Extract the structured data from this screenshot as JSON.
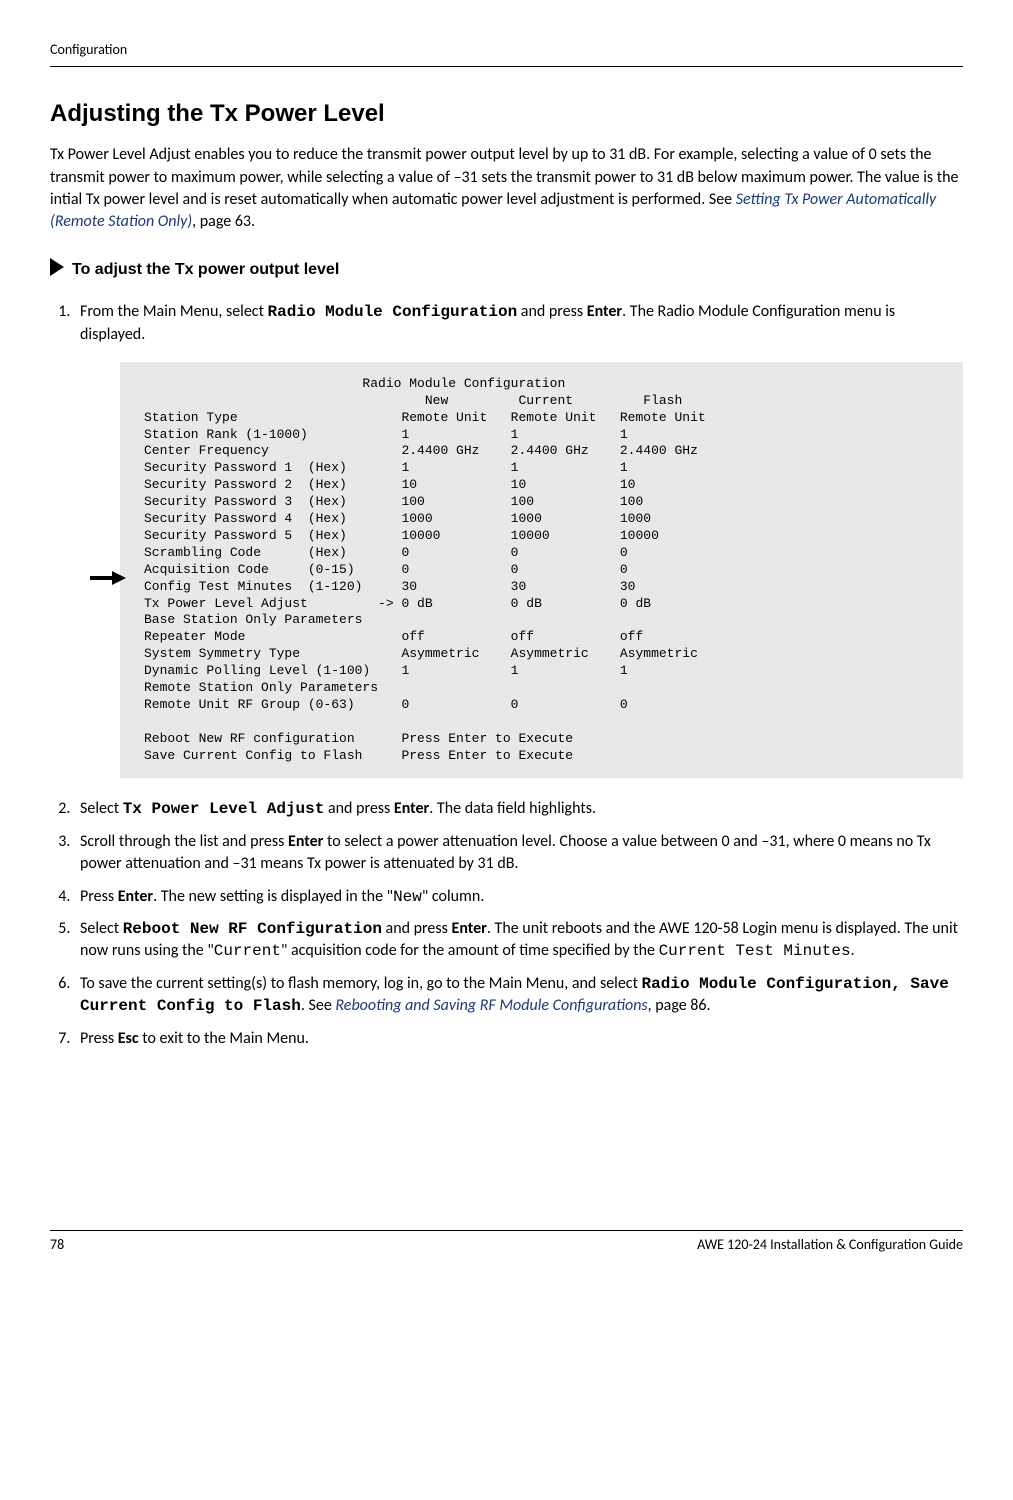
{
  "header": "Configuration",
  "heading": "Adjusting the Tx Power Level",
  "intro_pre": "Tx Power Level Adjust enables you to reduce the transmit power output level by up to 31 dB. For example, selecting a value of 0 sets the transmit power to maximum power, while selecting a value of –31 sets the transmit power to 31 dB below maximum power.  The value is the intial Tx power level and is reset automatically when automatic power level adjustment is performed. See ",
  "intro_link": "Setting Tx Power Automatically (Remote Station Only)",
  "intro_post": ", page 63.",
  "proc_title": "To adjust the Tx power output level",
  "step1_pre": "From the Main Menu, select ",
  "step1_cmd": "Radio Module Configuration",
  "step1_mid": " and press ",
  "step1_key": "Enter",
  "step1_post": ". The Radio Module Configuration menu is displayed.",
  "terminal": "                            Radio Module Configuration\n                                    New         Current         Flash\nStation Type                     Remote Unit   Remote Unit   Remote Unit\nStation Rank (1-1000)            1             1             1\nCenter Frequency                 2.4400 GHz    2.4400 GHz    2.4400 GHz\nSecurity Password 1  (Hex)       1             1             1\nSecurity Password 2  (Hex)       10            10            10\nSecurity Password 3  (Hex)       100           100           100\nSecurity Password 4  (Hex)       1000          1000          1000\nSecurity Password 5  (Hex)       10000         10000         10000\nScrambling Code      (Hex)       0             0             0\nAcquisition Code     (0-15)      0             0             0\nConfig Test Minutes  (1-120)     30            30            30\nTx Power Level Adjust         -> 0 dB          0 dB          0 dB\nBase Station Only Parameters\nRepeater Mode                    off           off           off\nSystem Symmetry Type             Asymmetric    Asymmetric    Asymmetric\nDynamic Polling Level (1-100)    1             1             1\nRemote Station Only Parameters\nRemote Unit RF Group (0-63)      0             0             0\n\nReboot New RF configuration      Press Enter to Execute\nSave Current Config to Flash     Press Enter to Execute",
  "step2_pre": "Select ",
  "step2_cmd": "Tx Power Level Adjust",
  "step2_mid": " and press ",
  "step2_key": "Enter",
  "step2_post": ". The data field highlights.",
  "step3_pre": "Scroll through the list and press ",
  "step3_key": "Enter",
  "step3_post": " to select a power attenuation level. Choose a value between 0 and –31, where 0 means no Tx power attenuation and –31 means Tx power is attenuated by 31 dB.",
  "step4_pre": "Press ",
  "step4_key": "Enter",
  "step4_mid": ". The new setting is displayed in the \"",
  "step4_col": "New",
  "step4_post": "\" column.",
  "step5_pre": "Select ",
  "step5_cmd": "Reboot New RF Configuration",
  "step5_mid": " and press ",
  "step5_key": "Enter",
  "step5_mid2": ". The unit reboots and the AWE  120-58 Login menu is displayed. The unit now runs using the \"",
  "step5_cur": "Current",
  "step5_mid3": "\" acquisition code for the amount of time specified by the ",
  "step5_ctm": "Current Test Minutes",
  "step5_post": ".",
  "step6_pre": "To save the current setting(s) to flash memory, log in, go to the Main Menu, and select ",
  "step6_cmd": "Radio Module Configuration, Save Current Config to Flash",
  "step6_mid": ". See ",
  "step6_link": "Rebooting and Saving RF Module Configurations",
  "step6_post": ", page 86.",
  "step7_pre": "Press ",
  "step7_key": "Esc",
  "step7_post": " to exit to the Main Menu.",
  "footer_page": "78",
  "footer_title": "AWE 120-24 Installation & Configuration Guide"
}
